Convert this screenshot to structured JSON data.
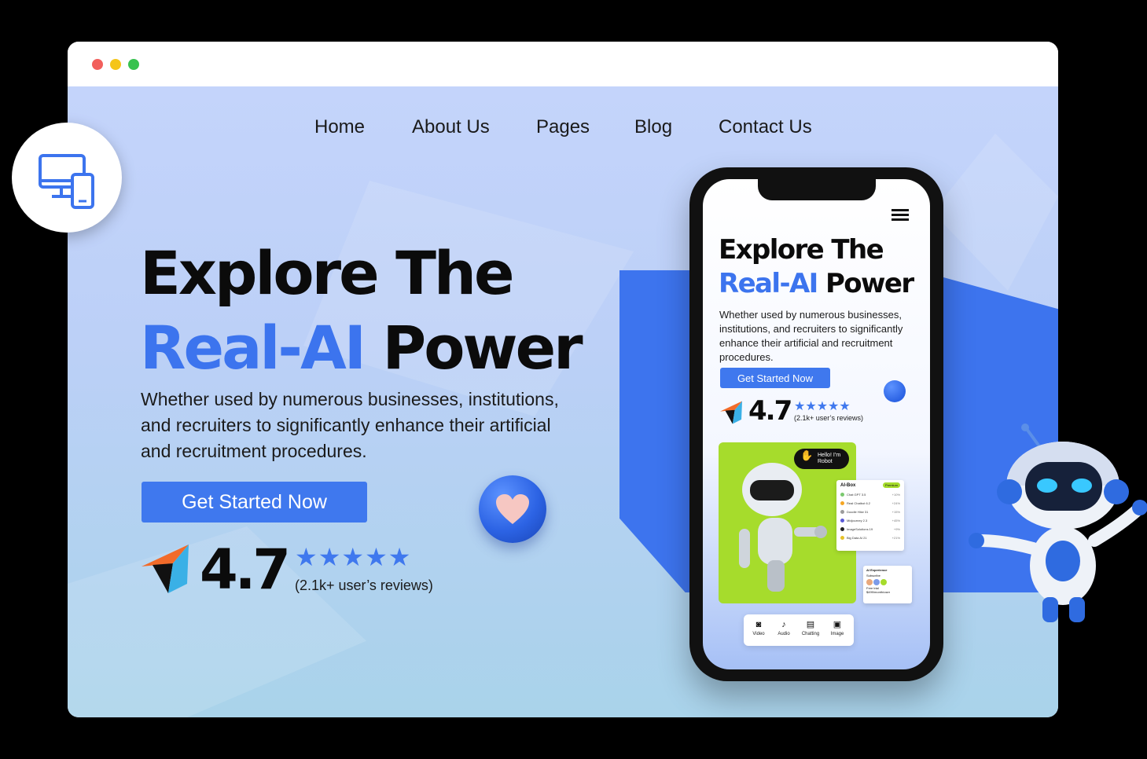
{
  "nav": {
    "items": [
      {
        "label": "Home"
      },
      {
        "label": "About Us"
      },
      {
        "label": "Pages"
      },
      {
        "label": "Blog"
      },
      {
        "label": "Contact Us"
      }
    ]
  },
  "hero": {
    "title_line1": "Explore The",
    "title_accent": "Real-AI",
    "title_rest": "Power",
    "description": "Whether used by numerous businesses, institutions, and recruiters to significantly enhance their artificial and recruitment procedures.",
    "cta_label": "Get Started Now",
    "rating": "4.7",
    "stars": "★★★★★",
    "reviews": "(2.1k+ user’s reviews)"
  },
  "mobile": {
    "title_line1": "Explore The",
    "title_accent": "Real-AI",
    "title_rest": "Power",
    "description": "Whether used by numerous businesses, institutions, and recruiters to significantly enhance their artificial and recruitment procedures.",
    "cta_label": "Get Started Now",
    "rating": "4.7",
    "stars": "★★★★★",
    "reviews": "(2.1k+ user’s reviews)",
    "speech_bubble": "Hello! I’m Robot",
    "ai_box": {
      "title": "AI-Box",
      "pill": "Premium",
      "rows": [
        {
          "name": "Chat GPT 3.5",
          "pct": "+10%",
          "color": "#7bc96f"
        },
        {
          "name": "Real Chatbot 6.2",
          "pct": "+24%",
          "color": "#f5a623"
        },
        {
          "name": "Doodle Hike 31",
          "pct": "+15%",
          "color": "#9b9b9b"
        },
        {
          "name": "Midjourney 2.3",
          "pct": "+45%",
          "color": "#5a5ad6"
        },
        {
          "name": "ImageSolutions 19",
          "pct": "+9%",
          "color": "#222222"
        },
        {
          "name": "Big Data AI 21",
          "pct": "+21%",
          "color": "#e6c229"
        }
      ]
    },
    "ai_experience": {
      "title": "AI Experience",
      "items": [
        "Subscribe",
        "Free trial",
        "$499/month/user"
      ]
    },
    "media": [
      {
        "label": "Video",
        "icon": "video-icon",
        "glyph": "◙"
      },
      {
        "label": "Audio",
        "icon": "audio-icon",
        "glyph": "♪"
      },
      {
        "label": "Chatting",
        "icon": "chat-icon",
        "glyph": "▤"
      },
      {
        "label": "Image",
        "icon": "image-icon",
        "glyph": "▣"
      }
    ]
  },
  "colors": {
    "accent": "#3c74ee",
    "button": "#3f78ee",
    "robot_card": "#a6dc2c"
  }
}
